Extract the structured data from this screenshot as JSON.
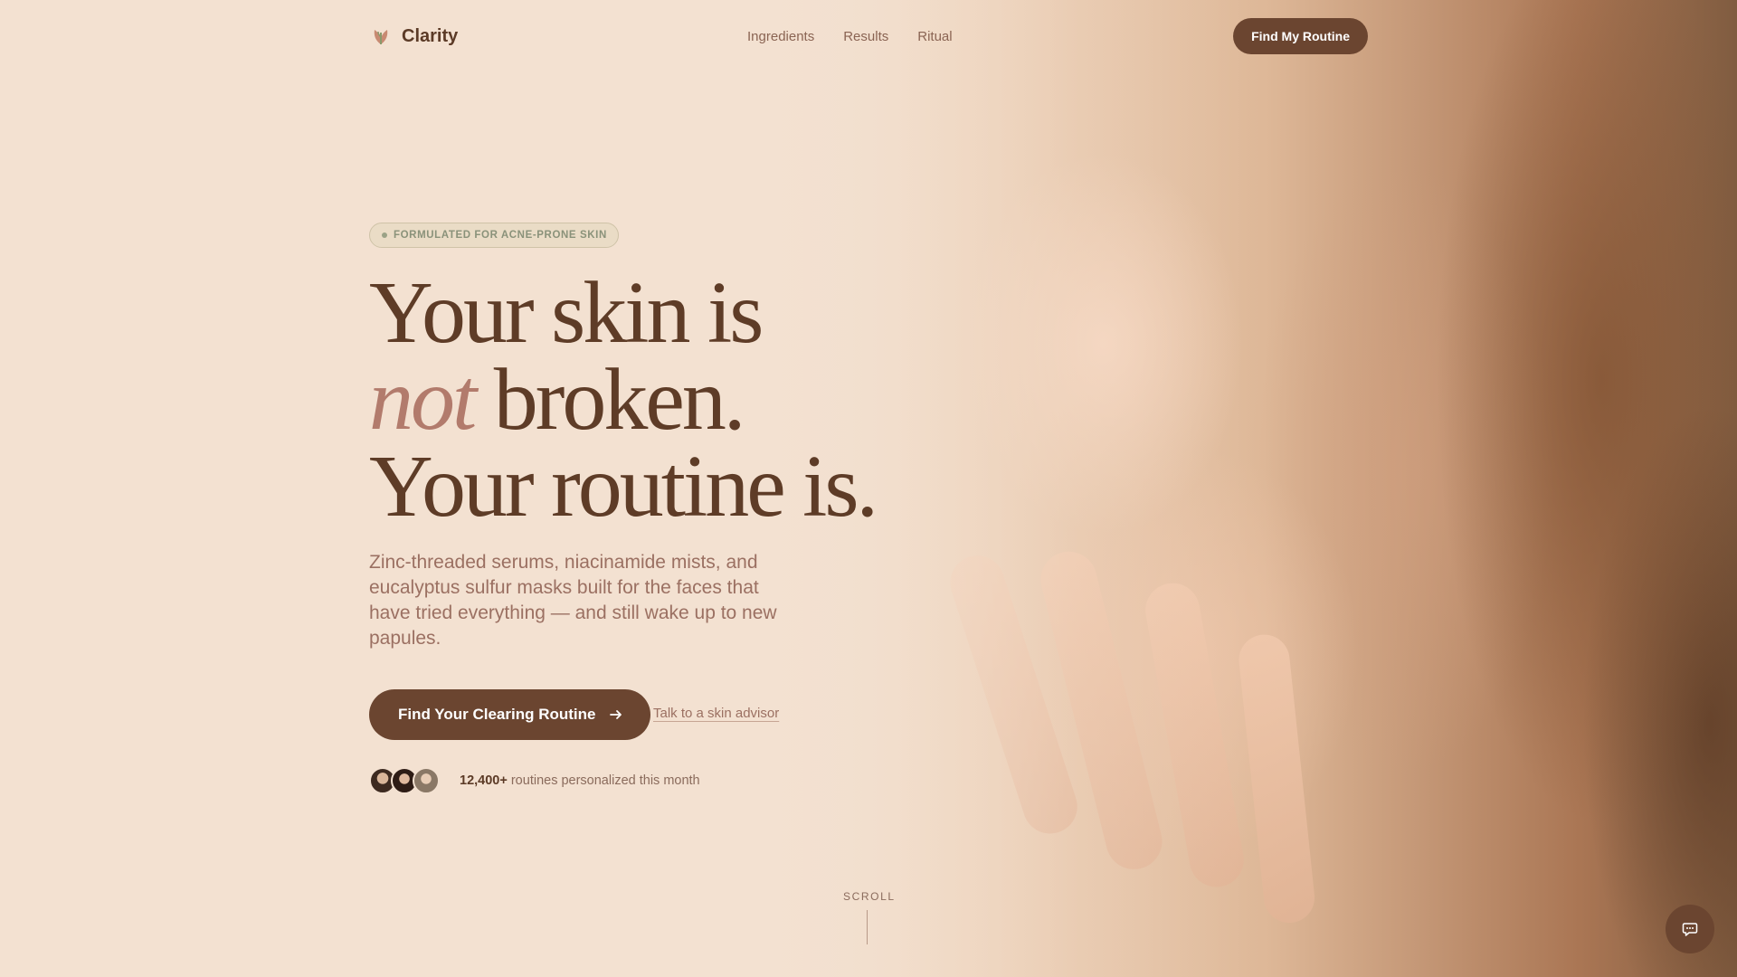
{
  "brand": {
    "name": "Clarity",
    "logo_icon": "leaf-shield-icon"
  },
  "nav": {
    "items": [
      "Ingredients",
      "Results",
      "Ritual"
    ]
  },
  "header": {
    "cta_label": "Find My Routine"
  },
  "hero": {
    "badge": "FORMULATED FOR ACNE-PRONE SKIN",
    "headline": {
      "line1": "Your skin is",
      "line2_accent": "not",
      "line2_rest": " broken.",
      "line3": "Your routine is."
    },
    "subcopy": "Zinc-threaded serums, niacinamide mists, and eucalyptus sulfur masks built for the faces that have tried everything — and still wake up to new papules.",
    "primary_cta": "Find Your Clearing Routine",
    "secondary_link": "Talk to a skin advisor"
  },
  "social_proof": {
    "count": "12,400+",
    "text": " routines personalized this month"
  },
  "scroll": {
    "label": "SCROLL"
  },
  "chat": {
    "icon": "chat-bubble-icon"
  },
  "colors": {
    "background": "#f3e1d1",
    "brand_brown": "#6b4530",
    "accent_rose": "#b27b6c",
    "badge_green": "#8a927a"
  }
}
